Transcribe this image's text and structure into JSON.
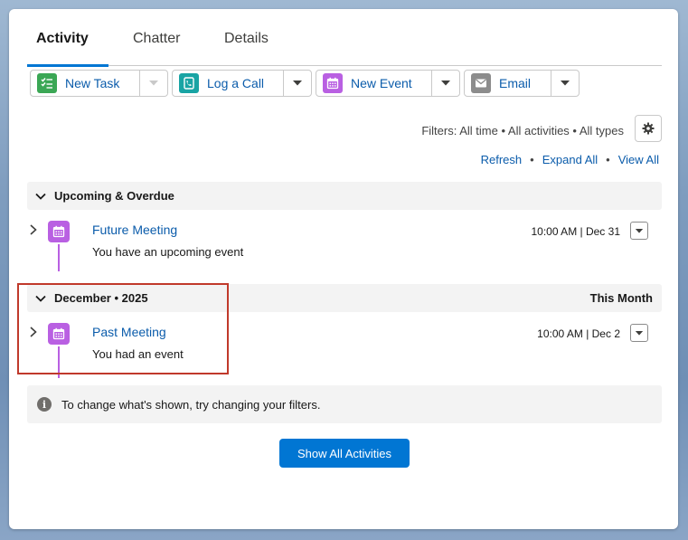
{
  "tabs": [
    {
      "label": "Activity"
    },
    {
      "label": "Chatter"
    },
    {
      "label": "Details"
    }
  ],
  "actions": [
    {
      "label": "New Task",
      "icon": "task-icon",
      "color": "#3ba755"
    },
    {
      "label": "Log a Call",
      "icon": "phone-icon",
      "color": "#19a4a4"
    },
    {
      "label": "New Event",
      "icon": "calendar-icon",
      "color": "#b960e2"
    },
    {
      "label": "Email",
      "icon": "email-icon",
      "color": "#8c8c8c"
    }
  ],
  "filters": {
    "text": "Filters: All time • All activities • All types"
  },
  "links": {
    "refresh": "Refresh",
    "expand_all": "Expand All",
    "view_all": "View All"
  },
  "sections": [
    {
      "label": "Upcoming & Overdue",
      "right": "",
      "items": [
        {
          "title": "Future Meeting",
          "subtitle": "You have an upcoming event",
          "when": "10:00 AM | Dec 31"
        }
      ]
    },
    {
      "label": "December • 2025",
      "right": "This Month",
      "items": [
        {
          "title": "Past Meeting",
          "subtitle": "You had an event",
          "when": "10:00 AM | Dec 2"
        }
      ]
    }
  ],
  "info": {
    "text": "To change what's shown, try changing your filters."
  },
  "show_all": {
    "label": "Show All Activities"
  },
  "colors": {
    "accent": "#0176d3",
    "link": "#0b5cab",
    "event": "#b960e2",
    "highlight": "#c0392b"
  }
}
